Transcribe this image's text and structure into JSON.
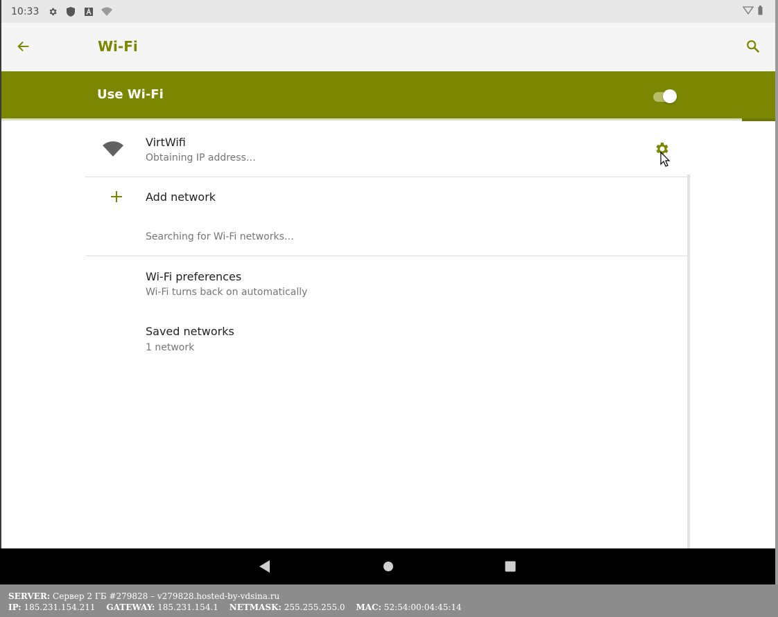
{
  "statusbar": {
    "time": "10:33",
    "icons": [
      "gear-icon",
      "shield-icon",
      "a-box-icon",
      "wifi-question-icon"
    ],
    "right_icons": [
      "signal-outline-icon",
      "battery-icon"
    ]
  },
  "toolbar": {
    "title": "Wi-Fi",
    "back_icon": "arrow-left-icon",
    "search_icon": "search-icon"
  },
  "master_switch": {
    "label": "Use Wi-Fi",
    "state": "on"
  },
  "current_network": {
    "name": "VirtWifi",
    "status": "Obtaining IP address…",
    "settings_icon": "gear-icon"
  },
  "add_network": {
    "label": "Add network"
  },
  "searching": {
    "label": "Searching for Wi-Fi networks…"
  },
  "preferences": {
    "title": "Wi-Fi preferences",
    "summary": "Wi-Fi turns back on automatically"
  },
  "saved": {
    "title": "Saved networks",
    "summary": "1 network"
  },
  "navbar": {
    "back": "back-triangle-icon",
    "home": "home-circle-icon",
    "recents": "recents-square-icon"
  },
  "info": {
    "server_label": "SERVER:",
    "server_value": "Сервер 2 ГБ #279828 – v279828.hosted-by-vdsina.ru",
    "ip_label": "IP:",
    "ip_value": "185.231.154.211",
    "gateway_label": "GATEWAY:",
    "gateway_value": "185.231.154.1",
    "netmask_label": "NETMASK:",
    "netmask_value": "255.255.255.0",
    "mac_label": "MAC:",
    "mac_value": "52:54:00:04:45:14"
  },
  "colors": {
    "accent": "#7b8700",
    "toolbar_bg": "#f5f5f5",
    "statusbar_bg": "#e8e8e8",
    "info_bg": "#8c8c8c"
  }
}
